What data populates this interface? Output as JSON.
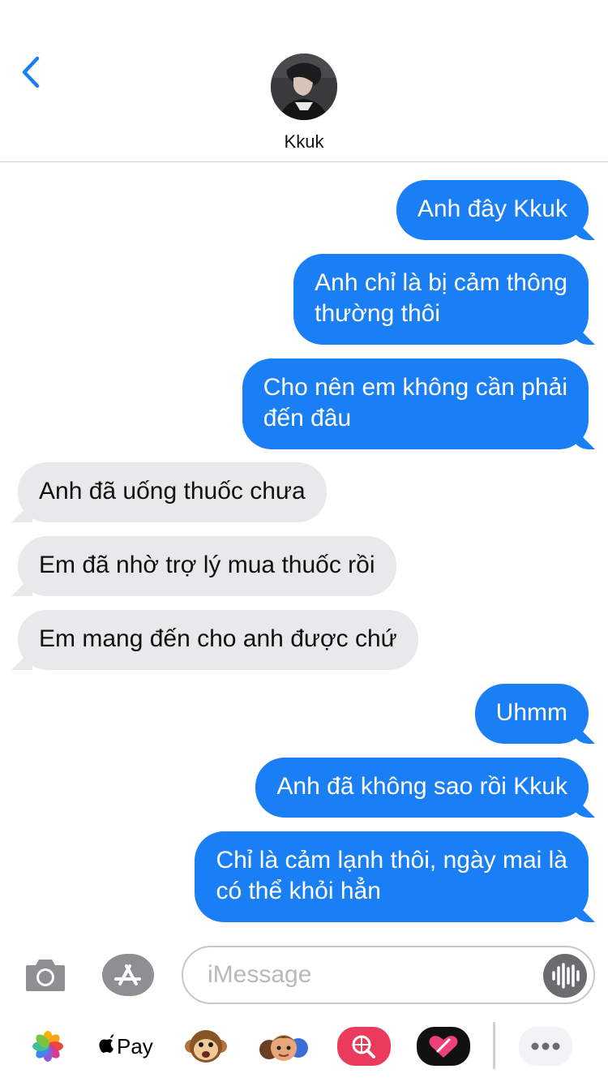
{
  "contact": {
    "name": "Kkuk"
  },
  "messages": [
    {
      "dir": "out",
      "text": "Anh đây Kkuk"
    },
    {
      "dir": "out",
      "text": "Anh chỉ là bị cảm thông\nthường thôi"
    },
    {
      "dir": "out",
      "text": "Cho nên em không cần phải\nđến đâu"
    },
    {
      "dir": "in",
      "text": "Anh đã uống thuốc chưa"
    },
    {
      "dir": "in",
      "text": "Em đã nhờ trợ lý mua thuốc rồi"
    },
    {
      "dir": "in",
      "text": "Em mang đến cho anh được chứ"
    },
    {
      "dir": "out",
      "text": "Uhmm"
    },
    {
      "dir": "out",
      "text": "Anh đã không sao rồi Kkuk"
    },
    {
      "dir": "out",
      "text": "Chỉ là cảm lạnh thôi, ngày mai là\ncó thể khỏi hẳn"
    }
  ],
  "composer": {
    "placeholder": "iMessage",
    "value": ""
  },
  "tray": {
    "apple_pay_label": "Pay",
    "items": [
      "photos-app-icon",
      "apple-pay-icon",
      "animoji-icon",
      "memoji-icon",
      "image-search-icon",
      "digital-touch-icon",
      "more-icon"
    ]
  },
  "colors": {
    "accent": "#1a7ef5",
    "incoming_bubble": "#e9e9eb",
    "battery": "#ffcc00"
  }
}
